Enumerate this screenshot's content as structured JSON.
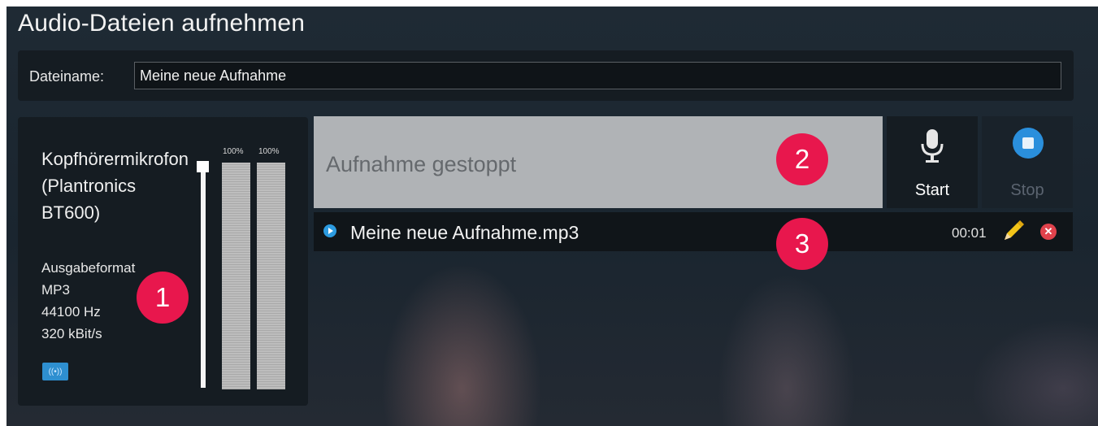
{
  "window": {
    "title": "Audio-Dateien aufnehmen"
  },
  "filename": {
    "label": "Dateiname:",
    "value": "Meine neue Aufnahme"
  },
  "device": {
    "name": "Kopfhörermikrofon (Plantronics BT600)",
    "format_lines": [
      "Ausgabeformat",
      "MP3",
      "44100 Hz",
      "320 kBit/s"
    ],
    "icon": "wireless-signal-icon",
    "meters": [
      {
        "label": "100%",
        "level": 1.0
      },
      {
        "label": "100%",
        "level": 1.0
      }
    ],
    "volume": 1.0
  },
  "recorder": {
    "status": "Aufnahme gestoppt",
    "start_label": "Start",
    "stop_label": "Stop",
    "start_icon": "microphone-icon",
    "stop_icon": "stop-circle-icon"
  },
  "recordings": [
    {
      "name": "Meine neue Aufnahme.mp3",
      "duration": "00:01",
      "icons": [
        "play-icon",
        "pencil-icon",
        "delete-icon"
      ]
    }
  ],
  "badges": [
    "1",
    "2",
    "3"
  ],
  "colors": {
    "badge": "#e8174d",
    "accent": "#2a8fdc",
    "delete": "#e0424c"
  }
}
